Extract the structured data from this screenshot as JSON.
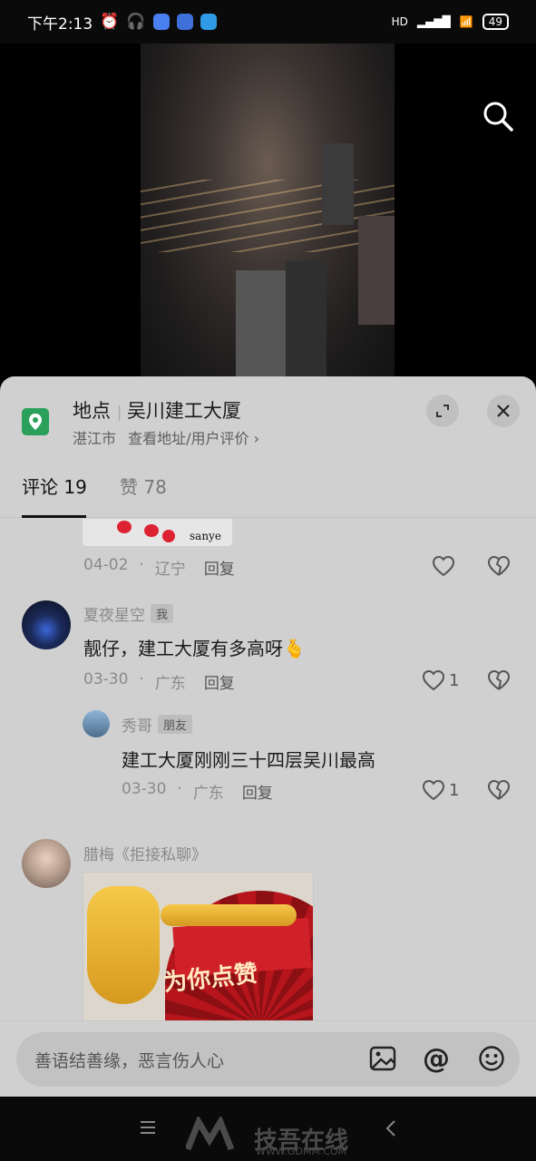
{
  "status_bar": {
    "time": "下午2:13",
    "battery": "49",
    "network": "HD"
  },
  "video": {
    "search_icon": "search-icon"
  },
  "location": {
    "label": "地点",
    "name": "吴川建工大厦",
    "city": "湛江市",
    "link": "查看地址/用户评价",
    "chevron": "›"
  },
  "tabs": {
    "comments": "评论 19",
    "likes": "赞 78"
  },
  "sticker_top": {
    "text": "sanye"
  },
  "comments": [
    {
      "date": "04-02",
      "region": "辽宁",
      "reply": "回复"
    },
    {
      "user": "夏夜星空",
      "tag": "我",
      "text": "靓仔，建工大厦有多高呀",
      "emoji": "🫰",
      "date": "03-30",
      "region": "广东",
      "reply": "回复",
      "likes": "1"
    },
    {
      "user": "秀哥",
      "tag": "朋友",
      "text": "建工大厦刚刚三十四层吴川最高",
      "date": "03-30",
      "region": "广东",
      "reply": "回复",
      "likes": "1"
    },
    {
      "user": "腊梅《拒接私聊》",
      "sticker_text": "为你点赞"
    }
  ],
  "separator": "·",
  "input": {
    "placeholder": "善语结善缘，恶言伤人心"
  },
  "watermark": {
    "title": "技吾在线",
    "url": "WWW.GDMM.COM"
  },
  "colors": {
    "accent_green": "#2aa05a",
    "sheet": "#d0d0d0"
  }
}
